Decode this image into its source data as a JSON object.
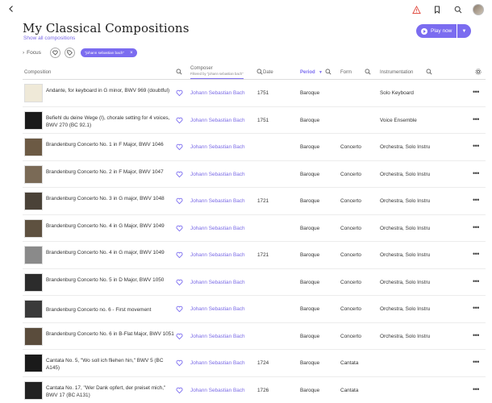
{
  "header": {
    "title": "My Classical Compositions",
    "show_all": "Show all compositions",
    "play_label": "Play now",
    "focus_label": "Focus",
    "filter_chip": "\"johann sebastian bach\""
  },
  "colors": {
    "accent": "#7b6cf0",
    "alert": "#e0473c"
  },
  "icons": {
    "back": "chevron-left-icon",
    "alert": "alert-triangle-icon",
    "bookmark": "bookmark-icon",
    "search": "search-icon"
  },
  "columns": {
    "composition": "Composition",
    "composer": "Composer",
    "composer_sub": "Filtered by \"johann sebastian bach\"",
    "date": "Date",
    "period": "Period",
    "form": "Form",
    "instrumentation": "Instrumentation"
  },
  "rows": [
    {
      "title": "Andante, for keyboard in G minor, BWV 969 (doubtful)",
      "composer": "Johann Sebastian Bach",
      "date": "1751",
      "period": "Baroque",
      "form": "",
      "instr": "Solo Keyboard",
      "thumb": "#efe9d8"
    },
    {
      "title": "Befiehl du deine Wege (I), chorale setting for 4 voices, BWV 270 (BC 92.1)",
      "composer": "Johann Sebastian Bach",
      "date": "1751",
      "period": "Baroque",
      "form": "",
      "instr": "Voice Ensemble",
      "thumb": "#1a1a1a"
    },
    {
      "title": "Brandenburg Concerto No. 1 in F Major, BWV 1046",
      "composer": "Johann Sebastian Bach",
      "date": "",
      "period": "Baroque",
      "form": "Concerto",
      "instr": "Orchestra, Solo Instrum",
      "thumb": "#6c5a44"
    },
    {
      "title": "Brandenburg Concerto No. 2 in F Major, BWV 1047",
      "composer": "Johann Sebastian Bach",
      "date": "",
      "period": "Baroque",
      "form": "Concerto",
      "instr": "Orchestra, Solo Instrum",
      "thumb": "#7a6a56"
    },
    {
      "title": "Brandenburg Concerto No. 3 in G major, BWV 1048",
      "composer": "Johann Sebastian Bach",
      "date": "1721",
      "period": "Baroque",
      "form": "Concerto",
      "instr": "Orchestra, Solo Instrum",
      "thumb": "#4a4238"
    },
    {
      "title": "Brandenburg Concerto No. 4 in G Major, BWV 1049",
      "composer": "Johann Sebastian Bach",
      "date": "",
      "period": "Baroque",
      "form": "Concerto",
      "instr": "Orchestra, Solo Instrum",
      "thumb": "#5e5140"
    },
    {
      "title": "Brandenburg Concerto No. 4 in G major, BWV 1049",
      "composer": "Johann Sebastian Bach",
      "date": "1721",
      "period": "Baroque",
      "form": "Concerto",
      "instr": "Orchestra, Solo Instrum",
      "thumb": "#8a8a8a"
    },
    {
      "title": "Brandenburg Concerto No. 5 in D Major, BWV 1050",
      "composer": "Johann Sebastian Bach",
      "date": "",
      "period": "Baroque",
      "form": "Concerto",
      "instr": "Orchestra, Solo Instrum",
      "thumb": "#2c2c2c"
    },
    {
      "title": "Brandenburg Concerto no. 6 - First movement",
      "composer": "Johann Sebastian Bach",
      "date": "",
      "period": "Baroque",
      "form": "Concerto",
      "instr": "Orchestra, Solo Instrum",
      "thumb": "#3a3a3a"
    },
    {
      "title": "Brandenburg Concerto No. 6 in B-Flat Major, BWV 1051",
      "composer": "Johann Sebastian Bach",
      "date": "",
      "period": "Baroque",
      "form": "Concerto",
      "instr": "Orchestra, Solo Instrum",
      "thumb": "#5a4c3c"
    },
    {
      "title": "Cantata No. 5, \"Wo soll ich fliehen hin,\" BWV 5 (BC A145)",
      "composer": "Johann Sebastian Bach",
      "date": "1724",
      "period": "Baroque",
      "form": "Cantata",
      "instr": "",
      "thumb": "#1a1a1a"
    },
    {
      "title": "Cantata No. 17, \"Wer Dank opfert, der preiset mich,\" BWV 17 (BC A131)",
      "composer": "Johann Sebastian Bach",
      "date": "1726",
      "period": "Baroque",
      "form": "Cantata",
      "instr": "",
      "thumb": "#222222"
    }
  ]
}
